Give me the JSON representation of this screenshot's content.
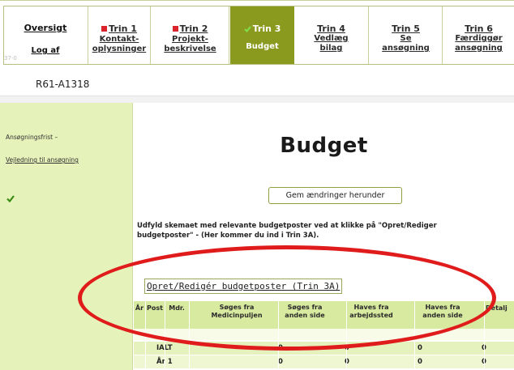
{
  "nav": {
    "overview": {
      "label": "Oversigt",
      "logout": "Log af",
      "code": "37-0"
    },
    "steps": [
      {
        "head": "Trin 1",
        "line1": "Kontakt-",
        "line2": "oplysninger",
        "status": "incomplete"
      },
      {
        "head": "Trin 2",
        "line1": "Projekt-",
        "line2": "beskrivelse",
        "status": "incomplete"
      },
      {
        "head": "Trin 3",
        "line1": "Budget",
        "line2": "",
        "status": "complete"
      },
      {
        "head": "Trin 4",
        "line1": "Vedlæg",
        "line2": "bilag",
        "status": "none"
      },
      {
        "head": "Trin 5",
        "line1": "Se",
        "line2": "ansøgning",
        "status": "none"
      },
      {
        "head": "Trin 6",
        "line1": "Færdiggør",
        "line2": "ansøgning",
        "status": "none"
      }
    ]
  },
  "case_id": "R61-A1318",
  "sidebar": {
    "deadline": "Ansøgningsfrist –",
    "guide_link": "Vejledning til ansøgning",
    "check_icon": "green-check-icon"
  },
  "main": {
    "title": "Budget",
    "save_button": "Gem ændringer herunder",
    "instruction": "Udfyld skemaet med relevante budgetposter ved at klikke på \"Opret/Rediger budgetposter\" - (Her kommer du ind i Trin 3A).",
    "edit_link": "Opret/Redigér budgetposter (Trin 3A)"
  },
  "table": {
    "headers": [
      "År",
      "Post",
      "Mdr.",
      "Søges fra Medicinpuljen",
      "Søges fra anden side",
      "Haves fra arbejdssted",
      "Haves fra anden side",
      "Detalj"
    ],
    "rows": [
      {
        "label": "IALT",
        "values": [
          "0",
          "0",
          "0",
          "0"
        ]
      },
      {
        "label": "År 1",
        "values": [
          "0",
          "0",
          "0",
          "0"
        ]
      }
    ]
  },
  "annotation": {
    "color": "#e01b1b"
  },
  "colors": {
    "active_tab": "#8a9a1e",
    "sidebar_bg": "#e5f2b9",
    "table_header_bg": "#d8eaa0"
  }
}
